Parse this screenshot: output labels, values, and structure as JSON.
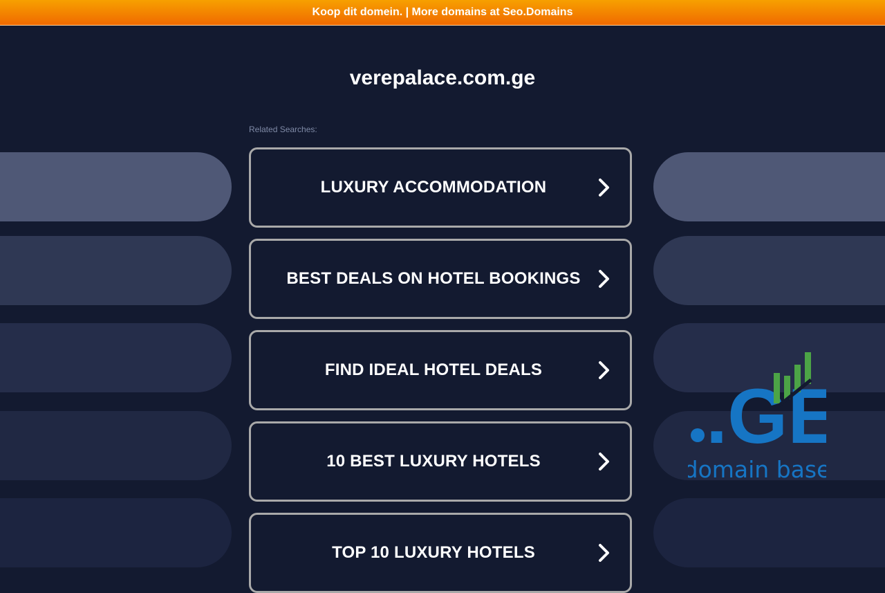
{
  "topbar": {
    "text": "Koop dit domein. | More domains at Seo.Domains"
  },
  "domain": "verepalace.com.ge",
  "related_label": "Related Searches:",
  "searches": [
    "LUXURY ACCOMMODATION",
    "BEST DEALS ON HOTEL BOOKINGS",
    "FIND IDEAL HOTEL DEALS",
    "10 BEST LUXURY HOTELS",
    "TOP 10 LUXURY HOTELS"
  ],
  "logo": {
    "mark": ".GE",
    "tagline": "domain base",
    "colors": {
      "blue": "#1675c4",
      "green": "#4ca446"
    }
  },
  "colors": {
    "background": "#131a30",
    "topbar": "#f58400",
    "pill_shades": [
      "#4f5876",
      "#2f3854",
      "#252d4a",
      "#202843",
      "#1c2440"
    ]
  },
  "icons": {
    "search_arrow": "chevron-right-icon"
  }
}
